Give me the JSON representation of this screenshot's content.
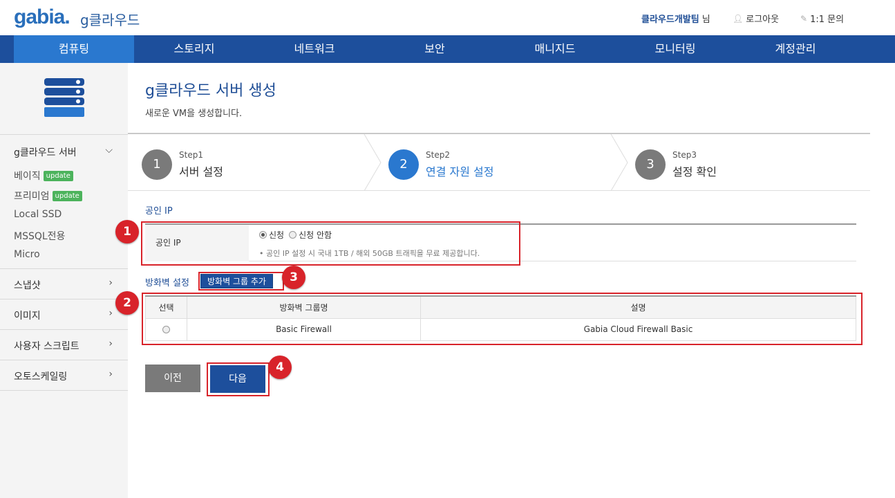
{
  "header": {
    "logo": "gabia.",
    "logo_sub": "g클라우드",
    "team_name": "클라우드개발팀",
    "team_suffix": "님",
    "logout": "로그아웃",
    "inquiry": "1:1 문의"
  },
  "nav": {
    "items": [
      "컴퓨팅",
      "스토리지",
      "네트워크",
      "보안",
      "매니지드",
      "모니터링",
      "계정관리"
    ],
    "active_index": 0
  },
  "sidebar": {
    "server_section": {
      "title": "g클라우드 서버",
      "items": [
        {
          "label": "베이직",
          "badge": "update"
        },
        {
          "label": "프리미엄",
          "badge": "update"
        },
        {
          "label": "Local SSD"
        },
        {
          "label": "MSSQL전용"
        },
        {
          "label": "Micro"
        }
      ]
    },
    "sections": [
      "스냅샷",
      "이미지",
      "사용자 스크립트",
      "오토스케일링"
    ]
  },
  "page": {
    "title": "g클라우드 서버 생성",
    "description": "새로운 VM을 생성합니다."
  },
  "steps": [
    {
      "number": "1",
      "label": "Step1",
      "name": "서버 설정",
      "active": false
    },
    {
      "number": "2",
      "label": "Step2",
      "name": "연결 자원 설정",
      "active": true
    },
    {
      "number": "3",
      "label": "Step3",
      "name": "설정 확인",
      "active": false
    }
  ],
  "public_ip": {
    "heading": "공인 IP",
    "row_label": "공인 IP",
    "option_apply": "신청",
    "option_no_apply": "신청 안함",
    "selected": "신청",
    "note": "• 공인 IP 설정 시 국내 1TB / 해외 50GB 트래픽을 무료 제공합니다."
  },
  "firewall": {
    "heading": "방화벽 설정",
    "add_button": "방화벽 그룹 추가",
    "columns": [
      "선택",
      "방화벽 그룹명",
      "설명"
    ],
    "rows": [
      {
        "name": "Basic Firewall",
        "description": "Gabia Cloud Firewall Basic",
        "selected": false
      }
    ]
  },
  "buttons": {
    "prev": "이전",
    "next": "다음"
  },
  "markers": [
    "1",
    "2",
    "3",
    "4"
  ],
  "colors": {
    "primary": "#1d4f9c",
    "active_nav": "#2a78cf",
    "highlight": "#d8232a",
    "badge": "#4cb35c"
  }
}
